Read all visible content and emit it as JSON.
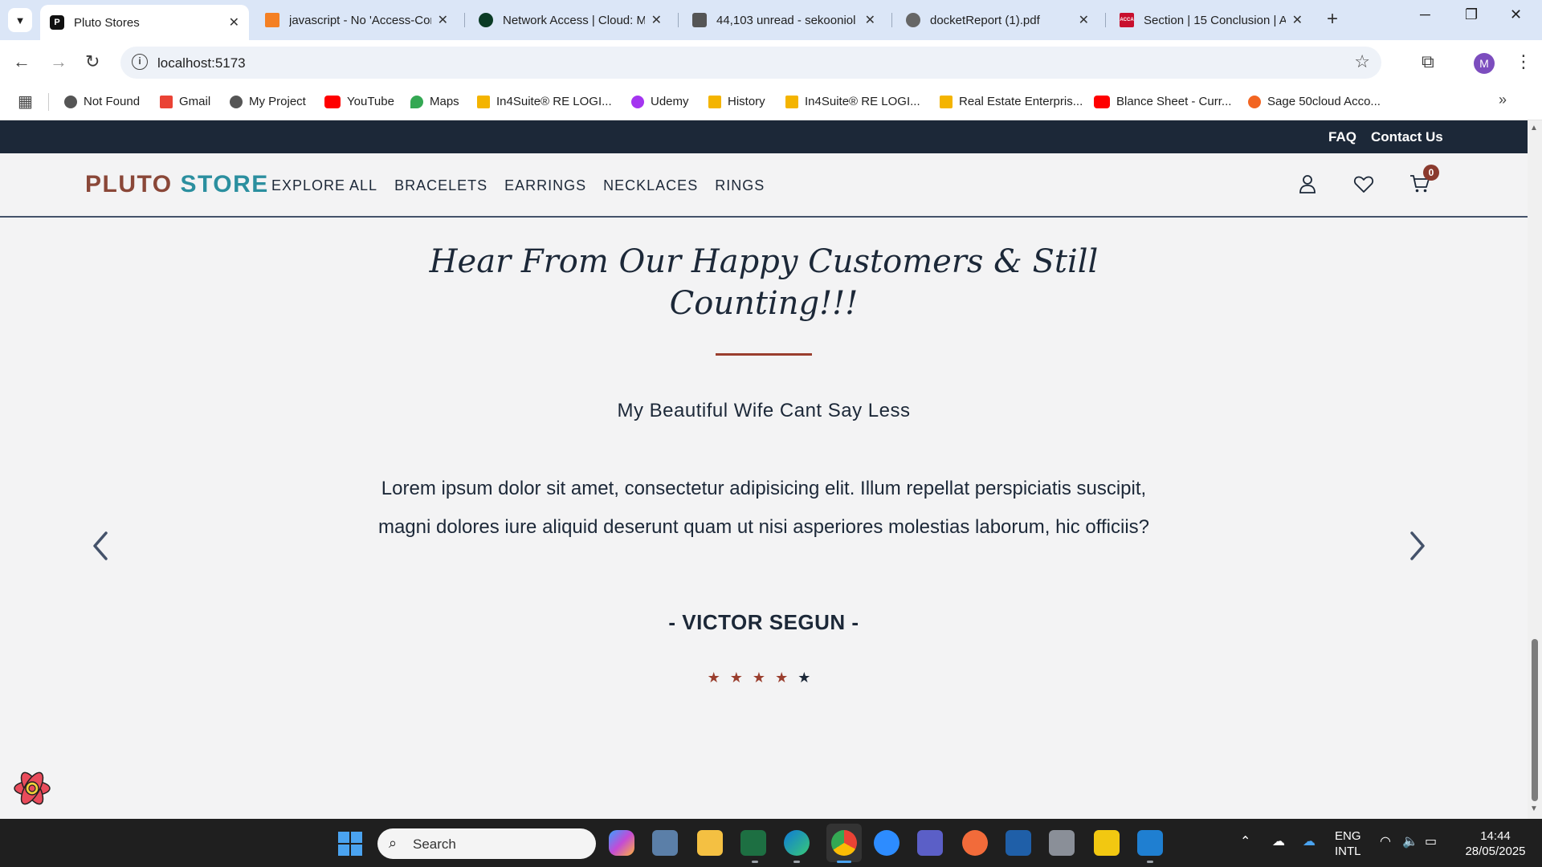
{
  "browser": {
    "tabs": [
      {
        "title": "Pluto Stores",
        "favicon": "P"
      },
      {
        "title": "javascript - No 'Access-Cor"
      },
      {
        "title": "Network Access | Cloud: M"
      },
      {
        "title": "44,103 unread - sekooniol"
      },
      {
        "title": "docketReport (1).pdf"
      },
      {
        "title": "Section | 15 Conclusion | A",
        "favicon": "ACCA"
      }
    ],
    "url": "localhost:5173",
    "profile_initial": "M",
    "bookmarks": [
      {
        "label": "Not Found"
      },
      {
        "label": "Gmail"
      },
      {
        "label": "My Project"
      },
      {
        "label": "YouTube"
      },
      {
        "label": "Maps"
      },
      {
        "label": "In4Suite® RE LOGI..."
      },
      {
        "label": "Udemy"
      },
      {
        "label": "History"
      },
      {
        "label": "In4Suite® RE LOGI..."
      },
      {
        "label": "Real Estate Enterpris..."
      },
      {
        "label": "Blance Sheet - Curr..."
      },
      {
        "label": "Sage 50cloud Acco..."
      }
    ]
  },
  "site": {
    "topbar": {
      "faq": "FAQ",
      "contact": "Contact Us"
    },
    "logo": {
      "part1": "PLUTO",
      "part2": "STORE"
    },
    "nav": [
      "EXPLORE ALL",
      "BRACELETS",
      "EARRINGS",
      "NECKLACES",
      "RINGS"
    ],
    "cart_count": "0",
    "testimonials": {
      "heading_line1": "Hear From Our Happy Customers & Still",
      "heading_line2": "Counting!!!",
      "title": "My Beautiful Wife Cant Say Less",
      "body": "Lorem ipsum dolor sit amet, consectetur adipisicing elit. Illum repellat perspiciatis suscipit, magni dolores iure aliquid deserunt quam ut nisi asperiores molestias laborum, hic officiis?",
      "author": "- VICTOR SEGUN -",
      "rating": 5,
      "stars": [
        "★",
        "★",
        "★",
        "★",
        "★"
      ]
    }
  },
  "taskbar": {
    "search_label": "Search",
    "lang_line1": "ENG",
    "lang_line2": "INTL",
    "time": "14:44",
    "date": "28/05/2025"
  },
  "colors": {
    "accent": "#9a3e2e",
    "navy": "#1c2838",
    "teal": "#2b8f9f"
  }
}
